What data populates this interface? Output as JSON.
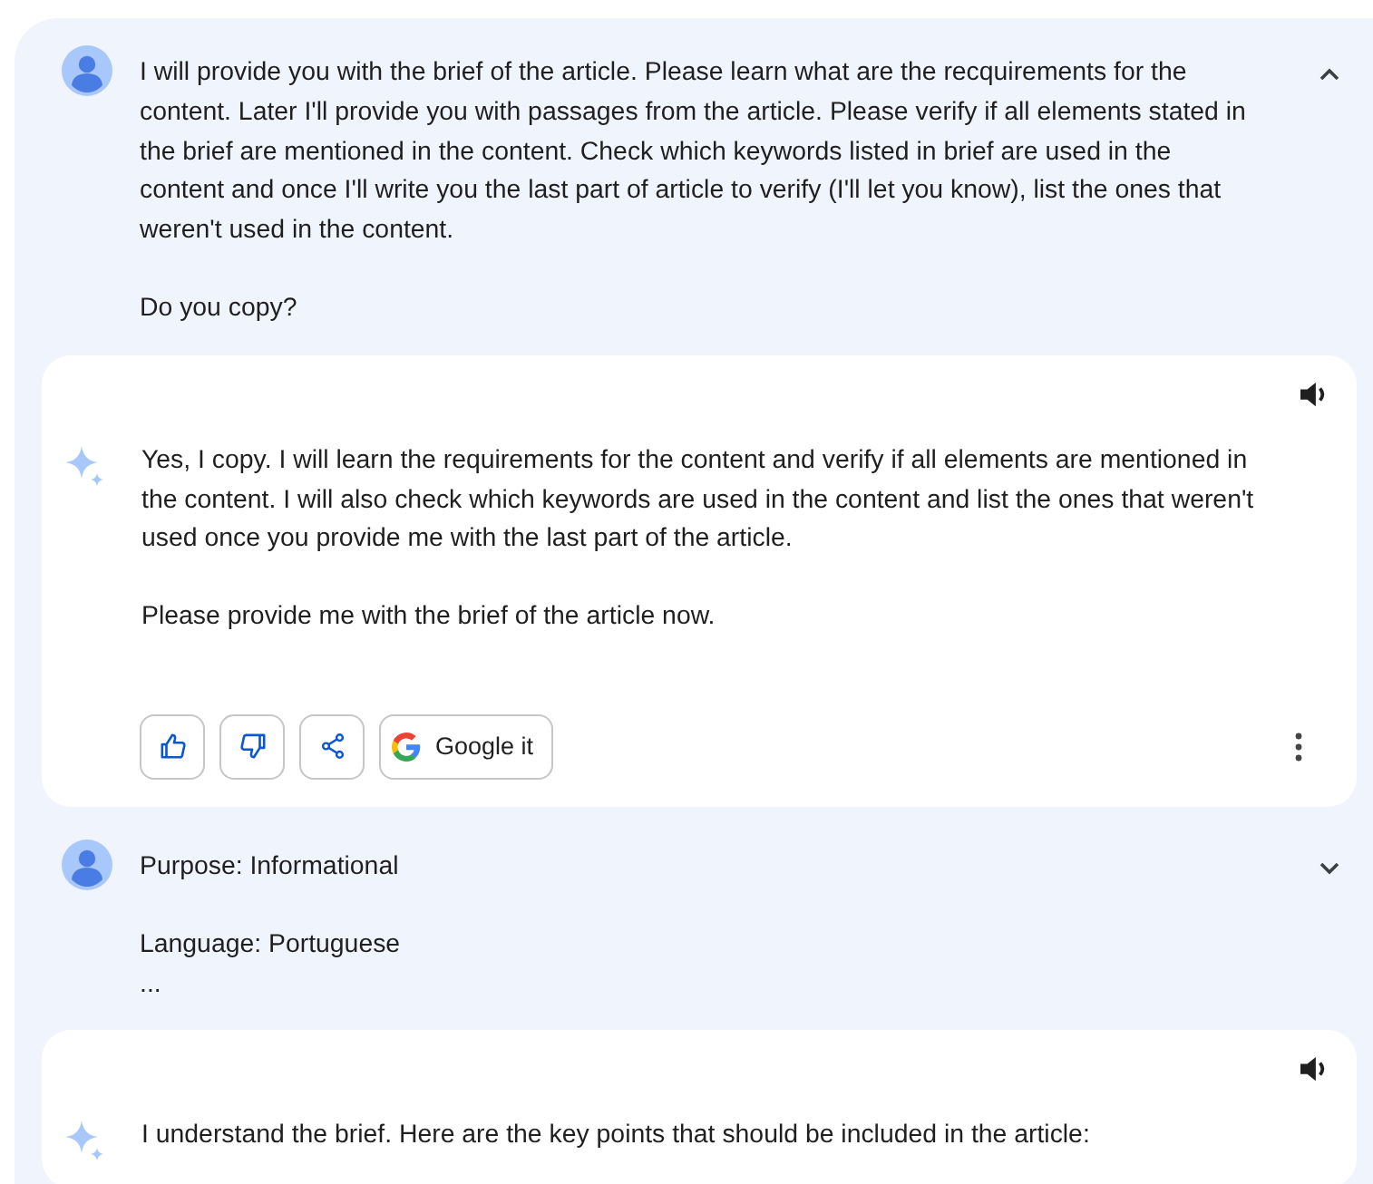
{
  "turns": [
    {
      "kind": "user",
      "expanded": true,
      "paragraphs": [
        "I will provide you with the brief of the article. Please learn what are the recquirements for the content. Later I'll provide you with passages from the article. Please verify if all elements stated in the brief are mentioned in the content. Check which keywords listed in brief are used in the content and once I'll write you the last part of article to verify (I'll let you know), list the ones that weren't used in the content.",
        "Do you copy?"
      ]
    },
    {
      "kind": "model",
      "paragraphs": [
        "Yes, I copy. I will learn the requirements for the content and verify if all elements are mentioned in the content. I will also check which keywords are used in the content and list the ones that weren't used once you provide me with the last part of the article.",
        "Please provide me with the brief of the article now."
      ],
      "actions": [
        {
          "kind": "like"
        },
        {
          "kind": "dislike"
        },
        {
          "kind": "share"
        },
        {
          "kind": "google",
          "label": "Google it"
        }
      ]
    },
    {
      "kind": "user",
      "expanded": false,
      "paragraphs": [
        "Purpose: Informational",
        "Language: Portuguese\n..."
      ]
    },
    {
      "kind": "model",
      "paragraphs": [
        "I understand the brief. Here are the key points that should be included in the article:"
      ]
    }
  ]
}
